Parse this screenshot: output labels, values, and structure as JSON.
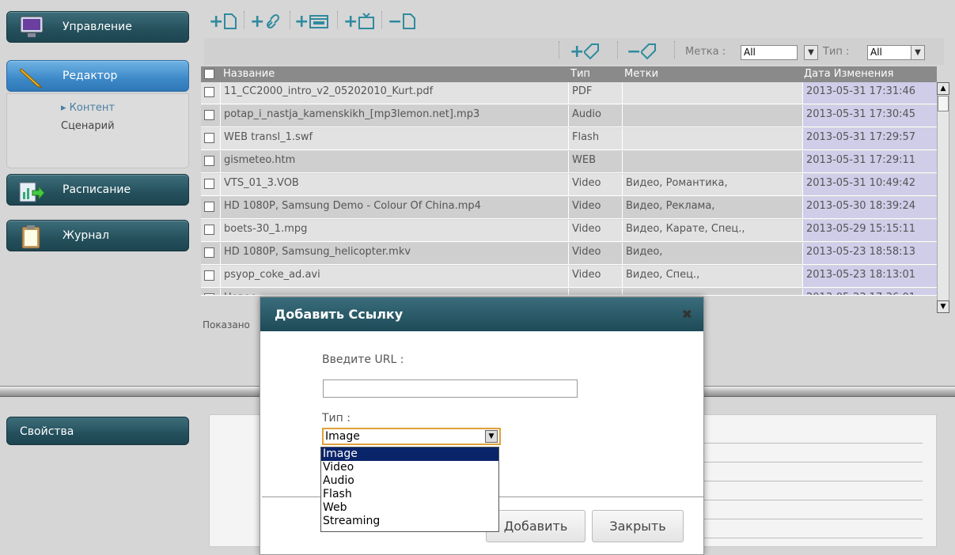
{
  "nav": {
    "management": "Управление",
    "editor": "Редактор",
    "content": "Контент",
    "scenario": "Сценарий",
    "schedule": "Расписание",
    "journal": "Журнал",
    "properties": "Свойства"
  },
  "toolbar": {
    "icons": [
      "add-file-icon",
      "add-link-icon",
      "add-form-icon",
      "add-tv-icon",
      "remove-file-icon"
    ]
  },
  "filters": {
    "add_tag_icon": "add-tag-icon",
    "remove_tag_icon": "remove-tag-icon",
    "tag_label": "Метка :",
    "tag_value": "All",
    "type_label": "Тип :",
    "type_value": "All"
  },
  "table": {
    "headers": {
      "name": "Название",
      "type": "Тип",
      "tags": "Метки",
      "date": "Дата Изменения"
    },
    "rows": [
      {
        "name": "11_CC2000_intro_v2_05202010_Kurt.pdf",
        "type": "PDF",
        "tags": "",
        "date": "2013-05-31 17:31:46"
      },
      {
        "name": "potap_i_nastja_kamenskikh_[mp3lemon.net].mp3",
        "type": "Audio",
        "tags": "",
        "date": "2013-05-31 17:30:45"
      },
      {
        "name": "WEB transl_1.swf",
        "type": "Flash",
        "tags": "",
        "date": "2013-05-31 17:29:57"
      },
      {
        "name": "gismeteo.htm",
        "type": "WEB",
        "tags": "",
        "date": "2013-05-31 17:29:11"
      },
      {
        "name": "VTS_01_3.VOB",
        "type": "Video",
        "tags": "Видео, Романтика,",
        "date": "2013-05-31 10:49:42"
      },
      {
        "name": "HD 1080P, Samsung Demo - Colour Of China.mp4",
        "type": "Video",
        "tags": "Видео, Реклама,",
        "date": "2013-05-30 18:39:24"
      },
      {
        "name": "boets-30_1.mpg",
        "type": "Video",
        "tags": "Видео, Карате, Спец.,",
        "date": "2013-05-29 15:15:11"
      },
      {
        "name": "HD 1080P, Samsung_helicopter.mkv",
        "type": "Video",
        "tags": "Видео,",
        "date": "2013-05-23 18:58:13"
      },
      {
        "name": "psyop_coke_ad.avi",
        "type": "Video",
        "tags": "Видео, Спец.,",
        "date": "2013-05-23 18:13:01"
      },
      {
        "name": "Новос",
        "type": "",
        "tags": "",
        "date": "2013-05-23 17:36:01"
      }
    ],
    "shown_text": "Показано"
  },
  "modal": {
    "title": "Добавить Ссылку",
    "close": "✖",
    "url_label": "Введите URL :",
    "url_value": "",
    "type_label": "Тип :",
    "type_selected": "Image",
    "type_options": [
      "Image",
      "Video",
      "Audio",
      "Flash",
      "Web",
      "Streaming"
    ],
    "add_button": "Добавить",
    "close_button": "Закрыть"
  },
  "colors": {
    "accent": "#2f8a9e",
    "nav": "#24505c",
    "nav_active": "#3d89c8",
    "date_bg": "#cfcde8"
  }
}
